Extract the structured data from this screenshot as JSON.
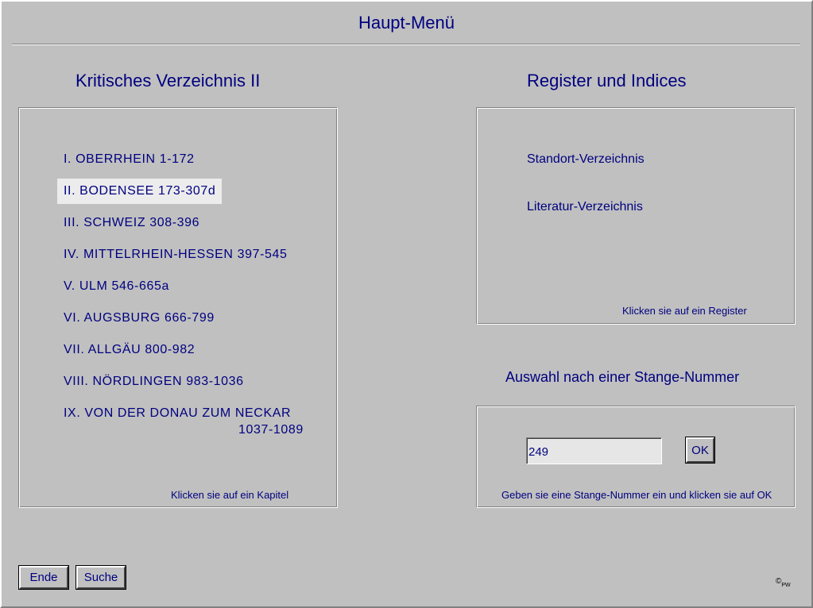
{
  "window": {
    "title": "Haupt-Menü"
  },
  "left_panel": {
    "heading": "Kritisches Verzeichnis II",
    "chapters": [
      {
        "label": "I. OBERRHEIN 1-172",
        "selected": false
      },
      {
        "label": "II. BODENSEE 173-307d",
        "selected": true
      },
      {
        "label": "III. SCHWEIZ 308-396",
        "selected": false
      },
      {
        "label": "IV. MITTELRHEIN-HESSEN 397-545",
        "selected": false
      },
      {
        "label": "V. ULM 546-665a",
        "selected": false
      },
      {
        "label": "VI. AUGSBURG 666-799",
        "selected": false
      },
      {
        "label": "VII. ALLGÄU 800-982",
        "selected": false
      },
      {
        "label": "VIII. NÖRDLINGEN 983-1036",
        "selected": false
      },
      {
        "label": "IX. VON DER DONAU ZUM NECKAR",
        "label_line2": "1037-1089",
        "selected": false
      }
    ],
    "hint": "Klicken sie auf ein Kapitel"
  },
  "register_panel": {
    "heading": "Register und Indices",
    "items": [
      {
        "label": "Standort-Verzeichnis"
      },
      {
        "label": "Literatur-Verzeichnis"
      }
    ],
    "hint": "Klicken sie auf ein Register"
  },
  "number_panel": {
    "heading": "Auswahl nach einer Stange-Nummer",
    "input_value": "249",
    "ok_label": "OK",
    "hint": "Geben sie eine Stange-Nummer ein und klicken sie auf OK"
  },
  "footer": {
    "ende_label": "Ende",
    "suche_label": "Suche",
    "copyright_symbol": "©",
    "copyright_initials": "PW"
  }
}
